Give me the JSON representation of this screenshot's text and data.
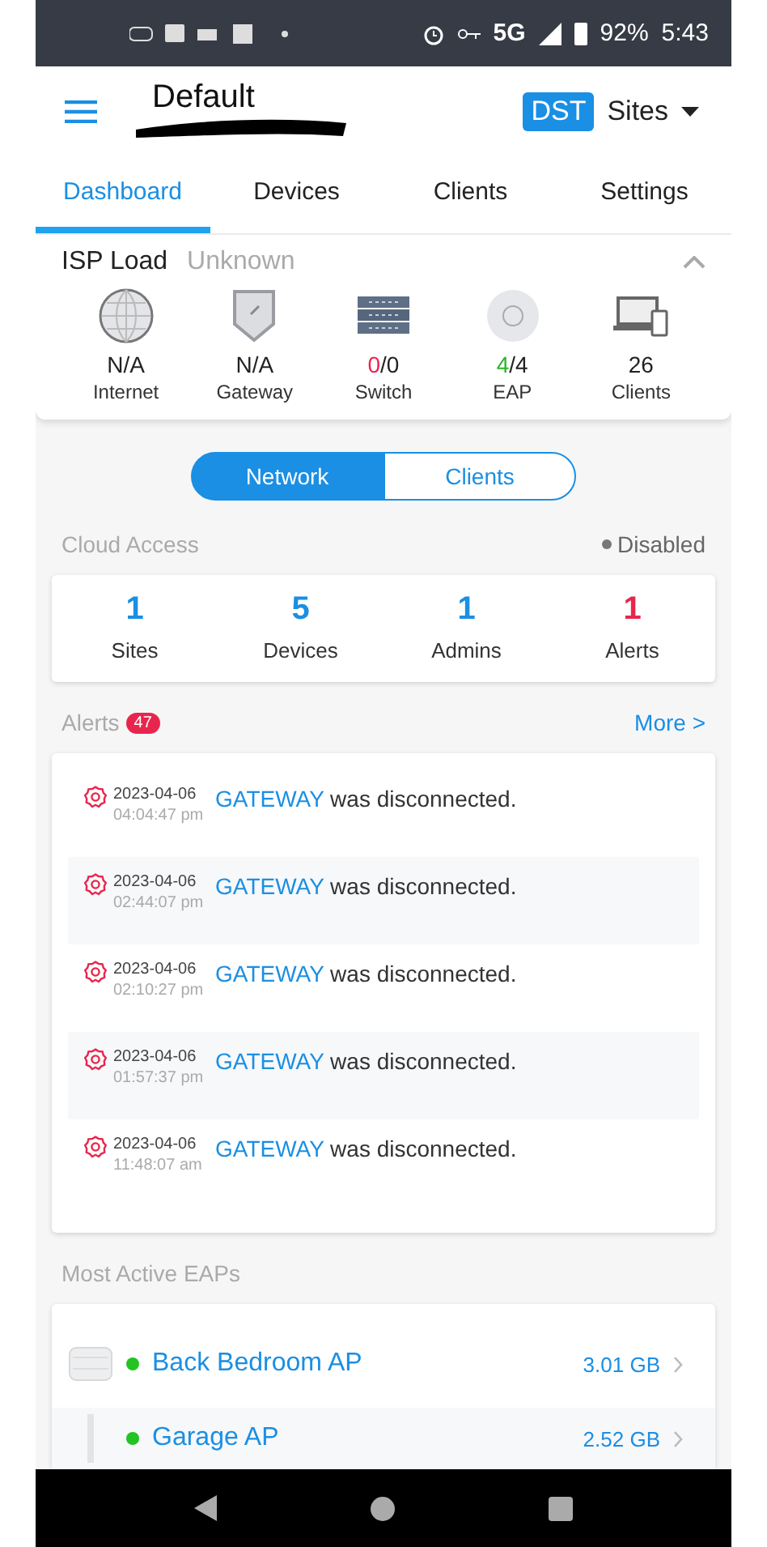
{
  "status_bar": {
    "network": "5G",
    "battery": "92%",
    "time": "5:43"
  },
  "header": {
    "title": "Default",
    "badge": "DST",
    "sites_label": "Sites"
  },
  "tabs": [
    {
      "label": "Dashboard",
      "selected": true
    },
    {
      "label": "Devices",
      "selected": false
    },
    {
      "label": "Clients",
      "selected": false
    },
    {
      "label": "Settings",
      "selected": false
    }
  ],
  "isp": {
    "label": "ISP Load",
    "value": "Unknown",
    "expanded": true,
    "items": [
      {
        "kind": "globe",
        "value": "N/A",
        "label": "Internet"
      },
      {
        "kind": "shield",
        "value": "N/A",
        "label": "Gateway"
      },
      {
        "kind": "switch",
        "online": "0",
        "total": "/0",
        "label": "Switch",
        "color": "#e8264d"
      },
      {
        "kind": "eap",
        "online": "4",
        "total": "/4",
        "label": "EAP",
        "color": "#2bb52b"
      },
      {
        "kind": "devices",
        "value": "26",
        "label": "Clients"
      }
    ]
  },
  "segments": [
    {
      "label": "Network",
      "selected": true
    },
    {
      "label": "Clients",
      "selected": false
    }
  ],
  "cloud_access": {
    "label": "Cloud Access",
    "status": "Disabled"
  },
  "stats": [
    {
      "value": "1",
      "label": "Sites",
      "color": "#1a8fe3"
    },
    {
      "value": "5",
      "label": "Devices",
      "color": "#1a8fe3"
    },
    {
      "value": "1",
      "label": "Admins",
      "color": "#1a8fe3"
    },
    {
      "value": "1",
      "label": "Alerts",
      "color": "#e8264d"
    }
  ],
  "alerts": {
    "label": "Alerts",
    "count": "47",
    "more": "More >",
    "items": [
      {
        "date": "2023-04-06",
        "time": "04:04:47 pm",
        "source": "GATEWAY",
        "message": "was disconnected."
      },
      {
        "date": "2023-04-06",
        "time": "02:44:07 pm",
        "source": "GATEWAY",
        "message": "was disconnected."
      },
      {
        "date": "2023-04-06",
        "time": "02:10:27 pm",
        "source": "GATEWAY",
        "message": "was disconnected."
      },
      {
        "date": "2023-04-06",
        "time": "01:57:37 pm",
        "source": "GATEWAY",
        "message": "was disconnected."
      },
      {
        "date": "2023-04-06",
        "time": "11:48:07 am",
        "source": "GATEWAY",
        "message": "was disconnected."
      }
    ]
  },
  "eaps": {
    "label": "Most Active EAPs",
    "items": [
      {
        "kind": "ceiling",
        "name": "Back Bedroom AP",
        "usage": "3.01 GB",
        "color": "#22c322"
      },
      {
        "kind": "wall",
        "name": "Garage AP",
        "usage": "2.52 GB",
        "color": "#22c322"
      }
    ]
  }
}
